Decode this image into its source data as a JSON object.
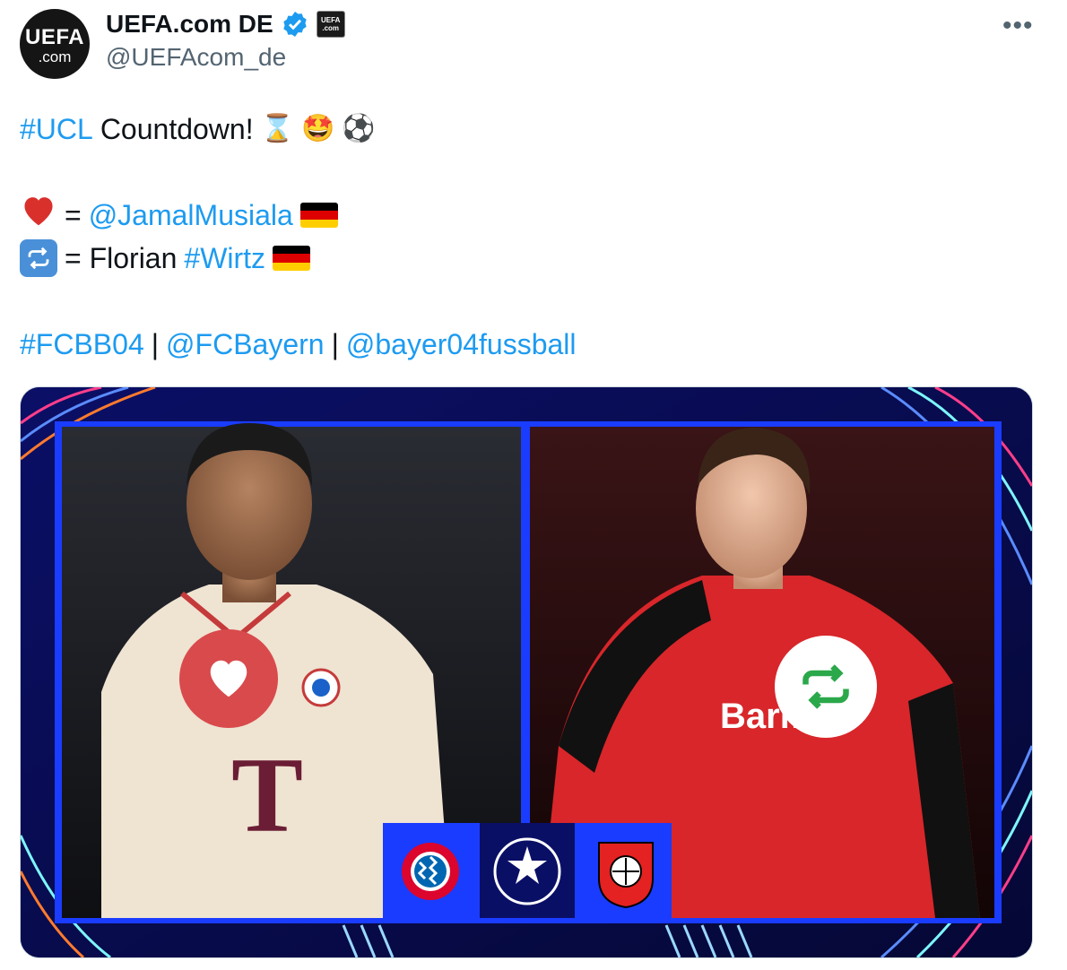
{
  "account": {
    "display_name": "UEFA.com DE",
    "handle": "@UEFAcom_de",
    "avatar_text_1": "UEFA",
    "avatar_text_2": ".com",
    "affiliate_text_1": "UEFA",
    "affiliate_text_2": ".com",
    "verified_color": "#1d9bf0"
  },
  "menu": {
    "more_label": "•••"
  },
  "tweet": {
    "line1": {
      "hashtag": "#UCL",
      "text": "Countdown!",
      "emojis": [
        "⌛",
        "🤩",
        "⚽"
      ]
    },
    "line2": {
      "icon": "heart-emoji",
      "equals": "=",
      "mention": "@JamalMusiala",
      "flag": "germany-flag"
    },
    "line3": {
      "icon": "repeat-emoji",
      "equals": "= Florian",
      "hashtag": "#Wirtz",
      "flag": "germany-flag"
    },
    "line4": {
      "tag1": "#FCBB04",
      "sep1": "|",
      "tag2": "@FCBayern",
      "sep2": "|",
      "tag3": "@bayer04fussball"
    },
    "link_color": "#1d9bf0"
  },
  "media": {
    "left_player_icon": "heart-icon",
    "right_player_icon": "repost-icon",
    "badges": [
      "fc-bayern-crest",
      "champions-league-starball",
      "bayer-leverkusen-crest"
    ],
    "sponsor_text_left": "T",
    "sponsor_text_right": "Barmer",
    "frame_color": "#1a3cff"
  }
}
